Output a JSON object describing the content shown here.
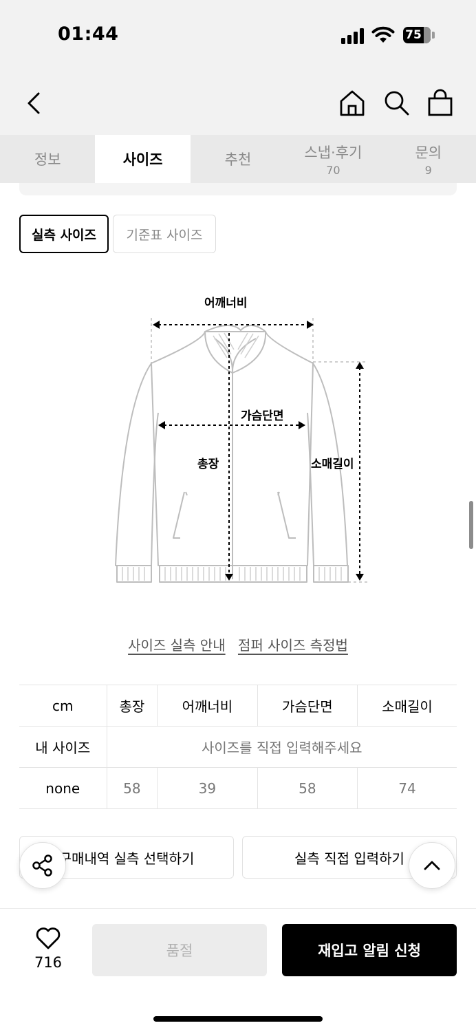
{
  "status_bar": {
    "time": "01:44",
    "battery": "75"
  },
  "nav": {
    "icons": [
      "back-icon",
      "home-icon",
      "search-icon",
      "shopping-bag-icon"
    ]
  },
  "tabs": [
    {
      "label": "정보",
      "count": ""
    },
    {
      "label": "사이즈",
      "count": ""
    },
    {
      "label": "추천",
      "count": ""
    },
    {
      "label": "스냅·후기",
      "count": "70"
    },
    {
      "label": "문의",
      "count": "9"
    }
  ],
  "size_type": {
    "measured": "실측 사이즈",
    "standard": "기준표 사이즈"
  },
  "diagram": {
    "shoulder": "어깨너비",
    "chest": "가슴단면",
    "length": "총장",
    "sleeve": "소매길이"
  },
  "links": {
    "guide": "사이즈 실측 안내",
    "method": "점퍼 사이즈 측정법"
  },
  "table": {
    "headers": [
      "cm",
      "총장",
      "어깨너비",
      "가슴단면",
      "소매길이"
    ],
    "my_size_label": "내 사이즈",
    "my_size_placeholder": "사이즈를 직접 입력해주세요",
    "rows": [
      {
        "size": "none",
        "values": [
          "58",
          "39",
          "58",
          "74"
        ]
      }
    ]
  },
  "actions": {
    "purchase_history": "구매내역 실측 선택하기",
    "direct_input": "실측 직접 입력하기"
  },
  "bottom": {
    "like_count": "716",
    "soldout": "품절",
    "restock": "재입고 알림 신청"
  }
}
